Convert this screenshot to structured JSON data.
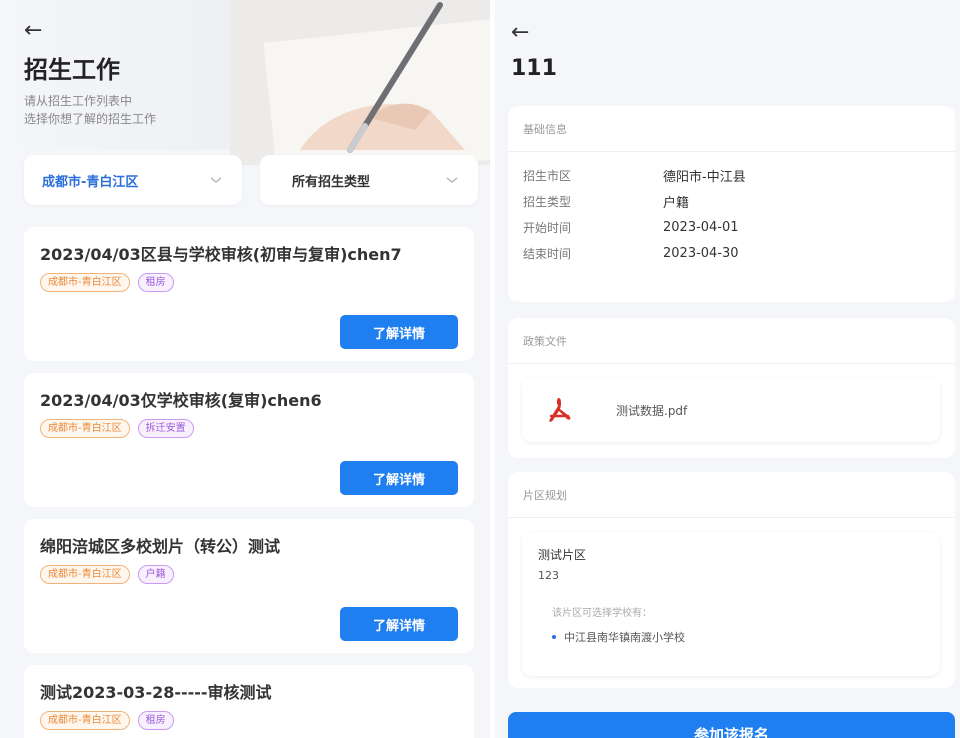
{
  "list_page": {
    "back_glyph": "←",
    "title": "招生工作",
    "subtitle_line1": "请从招生工作列表中",
    "subtitle_line2": "选择你想了解的招生工作",
    "filters": {
      "district": "成都市-青白江区",
      "type": "所有招生类型"
    },
    "detail_button_label": "了解详情",
    "cards": [
      {
        "title": "2023/04/03区县与学校审核(初审与复审)chen7",
        "tags": [
          {
            "text": "成都市-青白江区",
            "style": "orange"
          },
          {
            "text": "租房",
            "style": "purple"
          }
        ]
      },
      {
        "title": "2023/04/03仅学校审核(复审)chen6",
        "tags": [
          {
            "text": "成都市-青白江区",
            "style": "orange"
          },
          {
            "text": "拆迁安置",
            "style": "purple"
          }
        ]
      },
      {
        "title": "绵阳涪城区多校划片（转公）测试",
        "tags": [
          {
            "text": "成都市-青白江区",
            "style": "orange"
          },
          {
            "text": "户籍",
            "style": "purple"
          }
        ]
      },
      {
        "title": "测试2023-03-28-----审核测试",
        "tags": [
          {
            "text": "成都市-青白江区",
            "style": "orange"
          },
          {
            "text": "租房",
            "style": "purple"
          }
        ]
      }
    ]
  },
  "detail_page": {
    "back_glyph": "←",
    "title": "111",
    "basic_info": {
      "heading": "基础信息",
      "rows": [
        {
          "key": "招生市区",
          "value": "德阳市-中江县"
        },
        {
          "key": "招生类型",
          "value": "户籍"
        },
        {
          "key": "开始时间",
          "value": "2023-04-01"
        },
        {
          "key": "结束时间",
          "value": "2023-04-30"
        }
      ]
    },
    "policy": {
      "heading": "政策文件",
      "file_name": "测试数据.pdf",
      "file_icon": "pdf-icon"
    },
    "zone": {
      "heading": "片区规划",
      "name": "测试片区",
      "code": "123",
      "hint": "该片区可选择学校有：",
      "schools": [
        "中江县南华镇南渡小学校"
      ]
    },
    "join_button_label": "参加该报名"
  },
  "colors": {
    "accent": "#1f7ff0",
    "district_text": "#2a6edb",
    "tag_orange": "#e8883a",
    "tag_purple": "#9b59d8",
    "pdf_red": "#d93025"
  }
}
